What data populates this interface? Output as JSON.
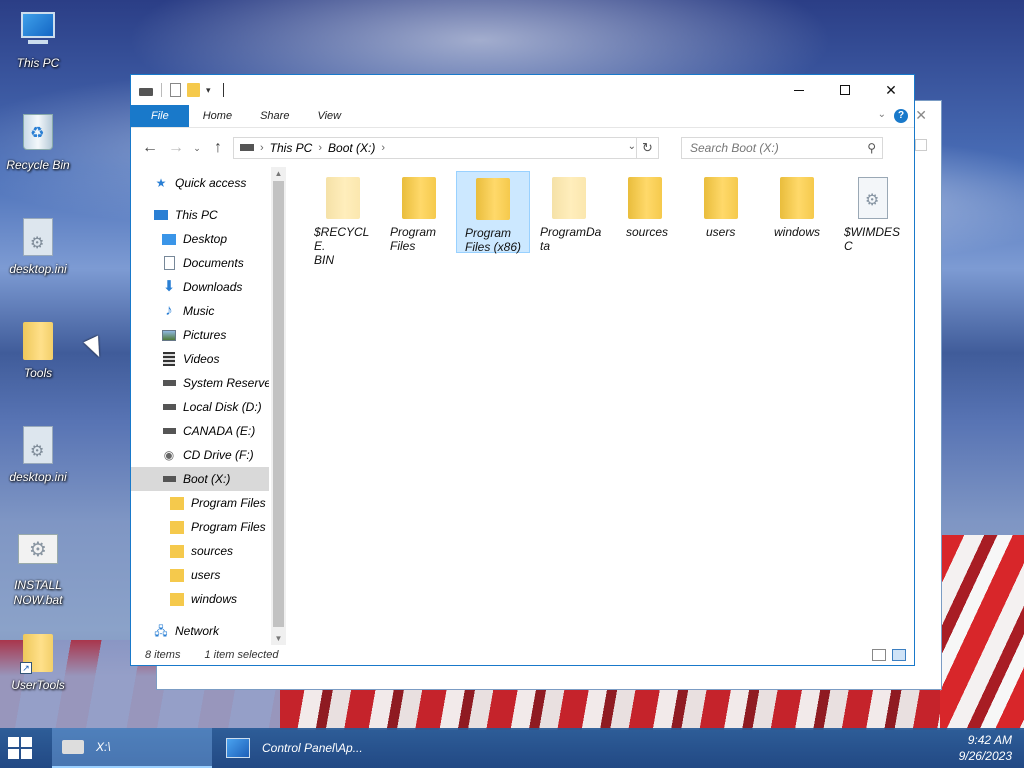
{
  "desktop": {
    "icons": [
      {
        "label": "This PC",
        "icon": "computer-icon"
      },
      {
        "label": "Recycle Bin",
        "icon": "recycle-bin-icon"
      },
      {
        "label": "desktop.ini",
        "icon": "settings-file-icon"
      },
      {
        "label": "Tools",
        "icon": "folder-icon"
      },
      {
        "label": "desktop.ini",
        "icon": "settings-file-icon"
      },
      {
        "label": "INSTALL NOW.bat",
        "icon": "batch-file-icon"
      },
      {
        "label": "UserTools",
        "icon": "folder-shortcut-icon"
      }
    ]
  },
  "explorer": {
    "ribbon_tabs": [
      "File",
      "Home",
      "Share",
      "View"
    ],
    "address": {
      "root": "This PC",
      "current": "Boot (X:)"
    },
    "search_placeholder": "Search Boot (X:)",
    "nav": [
      {
        "label": "Quick access",
        "icon": "star-icon"
      },
      {
        "label": "This PC",
        "icon": "computer-icon"
      },
      {
        "label": "Desktop",
        "icon": "desktop-icon"
      },
      {
        "label": "Documents",
        "icon": "documents-icon"
      },
      {
        "label": "Downloads",
        "icon": "download-icon"
      },
      {
        "label": "Music",
        "icon": "music-icon"
      },
      {
        "label": "Pictures",
        "icon": "pictures-icon"
      },
      {
        "label": "Videos",
        "icon": "videos-icon"
      },
      {
        "label": "System Reserved",
        "icon": "drive-icon"
      },
      {
        "label": "Local Disk (D:)",
        "icon": "drive-icon"
      },
      {
        "label": "CANADA (E:)",
        "icon": "drive-icon"
      },
      {
        "label": "CD Drive (F:)",
        "icon": "cd-drive-icon"
      },
      {
        "label": "Boot (X:)",
        "icon": "drive-icon",
        "selected": true
      },
      {
        "label": "Program Files",
        "icon": "folder-icon"
      },
      {
        "label": "Program Files (",
        "icon": "folder-icon"
      },
      {
        "label": "sources",
        "icon": "folder-icon"
      },
      {
        "label": "users",
        "icon": "folder-icon"
      },
      {
        "label": "windows",
        "icon": "folder-icon"
      },
      {
        "label": "Network",
        "icon": "network-icon"
      }
    ],
    "items": [
      {
        "name": "$RECYCLE.\nBIN",
        "type": "folder",
        "hidden": true
      },
      {
        "name": "Program\nFiles",
        "type": "folder"
      },
      {
        "name": "Program\nFiles (x86)",
        "type": "folder",
        "selected": true
      },
      {
        "name": "ProgramDa\nta",
        "type": "folder",
        "hidden": true
      },
      {
        "name": "sources",
        "type": "folder"
      },
      {
        "name": "users",
        "type": "folder"
      },
      {
        "name": "windows",
        "type": "folder"
      },
      {
        "name": "$WIMDESC",
        "type": "file"
      }
    ],
    "status": {
      "count": "8 items",
      "selection": "1 item selected"
    }
  },
  "taskbar": {
    "items": [
      {
        "label": "X:\\",
        "icon": "drive-icon",
        "active": true
      },
      {
        "label": "Control Panel\\Ap...",
        "icon": "control-panel-icon"
      }
    ],
    "time": "9:42 AM",
    "date": "9/26/2023"
  },
  "colors": {
    "accent": "#1979ca",
    "selection": "#cce8ff",
    "folder": "#f5c94c"
  }
}
